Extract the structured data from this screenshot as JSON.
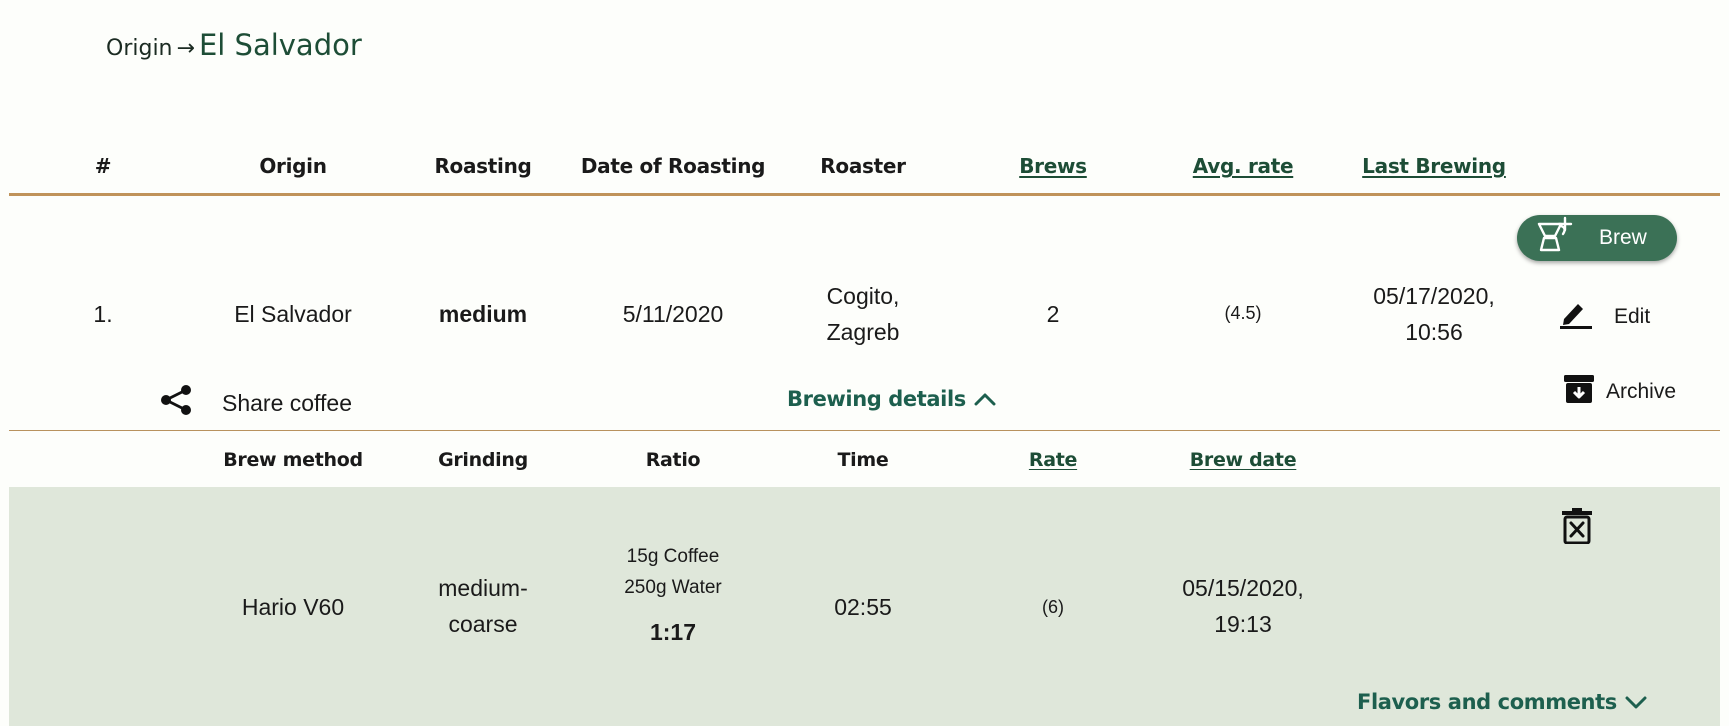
{
  "breadcrumb": {
    "root": "Origin",
    "separator": "→",
    "current": "El Salvador"
  },
  "coffee_table": {
    "headers": {
      "index": "#",
      "origin": "Origin",
      "roasting": "Roasting",
      "date_of_roasting": "Date of Roasting",
      "roaster": "Roaster",
      "brews": "Brews",
      "avg_rate": "Avg. rate",
      "last_brewing": "Last Brewing"
    },
    "row": {
      "index": "1.",
      "origin": "El Salvador",
      "roasting": "medium",
      "date_of_roasting": "5/11/2020",
      "roaster_line1": "Cogito,",
      "roaster_line2": "Zagreb",
      "brews": "2",
      "avg_rate": "(4.5)",
      "last_brewing_line1": "05/17/2020,",
      "last_brewing_line2": "10:56"
    }
  },
  "actions": {
    "brew": "Brew",
    "edit": "Edit",
    "archive": "Archive",
    "share": "Share coffee"
  },
  "brewing_details": {
    "toggle_label": "Brewing details",
    "headers": {
      "brew_method": "Brew method",
      "grinding": "Grinding",
      "ratio": "Ratio",
      "time": "Time",
      "rate": "Rate",
      "brew_date": "Brew date"
    },
    "row": {
      "brew_method": "Hario V60",
      "grinding_line1": "medium-",
      "grinding_line2": "coarse",
      "coffee": "15g Coffee",
      "water": "250g Water",
      "ratio": "1:17",
      "time": "02:55",
      "rate": "(6)",
      "brew_date_line1": "05/15/2020,",
      "brew_date_line2": "19:13"
    },
    "flavors_label": "Flavors and comments"
  },
  "colors": {
    "accent_green": "#3b7156",
    "link_green": "#1d5f4e",
    "divider_gold": "#c0935a",
    "panel_bg": "#dfe7da"
  }
}
